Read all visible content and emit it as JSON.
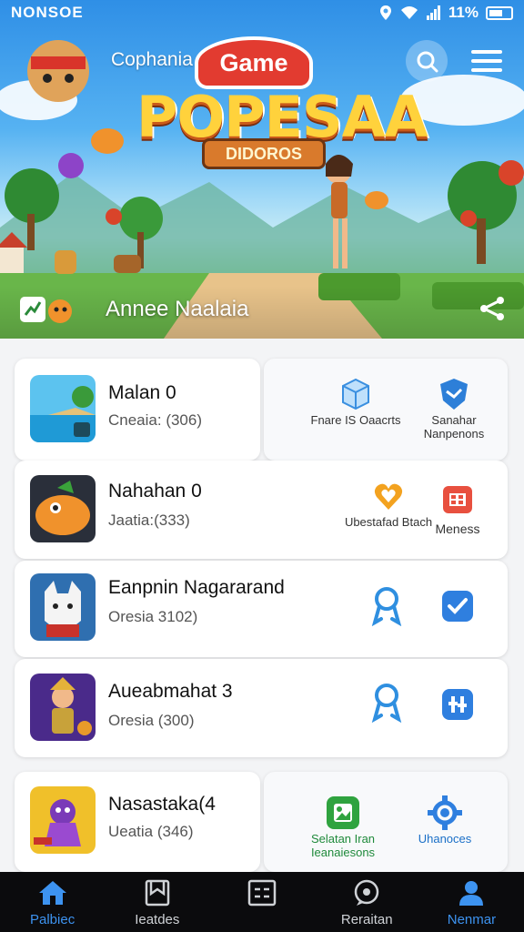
{
  "status": {
    "time": "NONSOE",
    "battery": "11%"
  },
  "header": {
    "app_name": "Cophania"
  },
  "hero": {
    "logo_top": "Game",
    "logo_title": "POPESAA",
    "logo_badge": "DIDOROS",
    "footer_label": "Annee Naalaia"
  },
  "items": [
    {
      "title": "Malan 0",
      "subtitle": "Cneaia: (306)",
      "thumb": "beach-game-thumbnail",
      "actions": [
        {
          "icon": "box-icon",
          "label": "Fnare IS Oaacrts"
        },
        {
          "icon": "shield-icon",
          "label": "Sanahar Nanpenons"
        }
      ]
    },
    {
      "title": "Nahahan 0",
      "subtitle": "Jaatia:(333)",
      "thumb": "dino-game-thumbnail",
      "actions": [
        {
          "icon": "heart-icon",
          "label": "Ubestafad Btach"
        },
        {
          "icon": "calendar-icon",
          "label": "Meness"
        }
      ]
    },
    {
      "title": "Eanpnin Nagararand",
      "subtitle": "Oresia 3102)",
      "thumb": "wolf-game-thumbnail",
      "actions": [
        {
          "icon": "ribbon-icon",
          "label": ""
        },
        {
          "icon": "check-icon",
          "label": ""
        }
      ]
    },
    {
      "title": "Aueabmahat 3",
      "subtitle": "Oresia (300)",
      "thumb": "knight-game-thumbnail",
      "actions": [
        {
          "icon": "ribbon-icon",
          "label": ""
        },
        {
          "icon": "controls-icon",
          "label": ""
        }
      ]
    },
    {
      "title": "Nasastaka(4",
      "subtitle": "Ueatia (346)",
      "thumb": "ninja-game-thumbnail",
      "actions": [
        {
          "icon": "gallery-icon",
          "label": "Selatan Iran Ieanaiesons"
        },
        {
          "icon": "gear-icon",
          "label": "Uhanoces"
        }
      ]
    }
  ],
  "nav": [
    {
      "label": "Palbiec",
      "icon": "home-icon",
      "active": true
    },
    {
      "label": "Ieatdes",
      "icon": "bookmark-icon",
      "active": false
    },
    {
      "label": "",
      "icon": "list-icon",
      "active": false
    },
    {
      "label": "Reraitan",
      "icon": "chat-icon",
      "active": false
    },
    {
      "label": "Nenmar",
      "icon": "profile-icon",
      "active": true
    }
  ],
  "colors": {
    "accent": "#3d93f0",
    "nav_bg": "#0b0b0d",
    "logo_red": "#e23b30",
    "logo_yellow": "#ffd23c"
  }
}
